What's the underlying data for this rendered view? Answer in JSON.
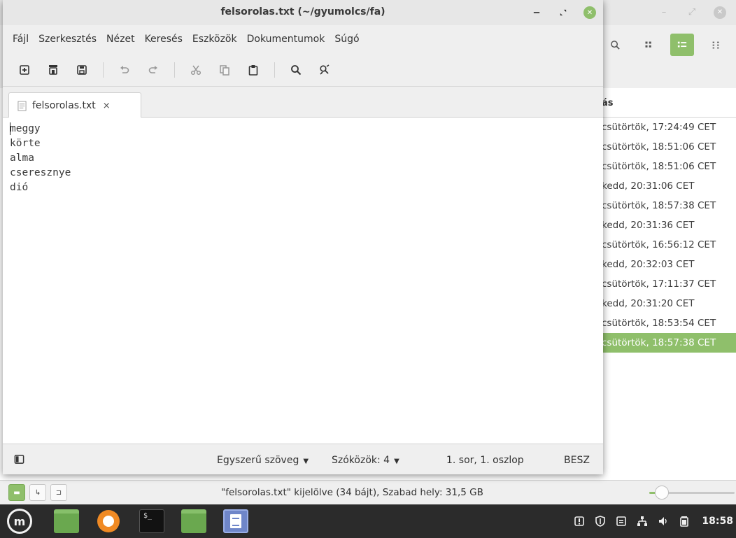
{
  "file_manager": {
    "column_header": "ás",
    "rows": [
      "csütörtök, 17:24:49 CET",
      "csütörtök, 18:51:06 CET",
      "csütörtök, 18:51:06 CET",
      "kedd, 20:31:06 CET",
      "csütörtök, 18:57:38 CET",
      "kedd, 20:31:36 CET",
      "csütörtök, 16:56:12 CET",
      "kedd, 20:32:03 CET",
      "csütörtök, 17:11:37 CET",
      "kedd, 20:31:20 CET",
      "csütörtök, 18:53:54 CET",
      "csütörtök, 18:57:38 CET"
    ],
    "selected_row": 11,
    "status": "\"felsorolas.txt\" kijelölve (34 bájt), Szabad hely: 31,5 GB",
    "zoom_level": 0.15
  },
  "editor": {
    "title": "felsorolas.txt (~/gyumolcs/fa)",
    "menu": [
      "Fájl",
      "Szerkesztés",
      "Nézet",
      "Keresés",
      "Eszközök",
      "Dokumentumok",
      "Súgó"
    ],
    "tab_label": "felsorolas.txt",
    "tab_close": "×",
    "lines": [
      "meggy",
      "körte",
      "alma",
      "cseresznye",
      "dió"
    ],
    "status": {
      "language": "Egyszerű szöveg",
      "indent": "Szóközök: 4",
      "position": "1. sor, 1. oszlop",
      "mode": "BESZ"
    }
  },
  "taskbar": {
    "clock": "18:58",
    "accent": "#8fbf6b"
  }
}
